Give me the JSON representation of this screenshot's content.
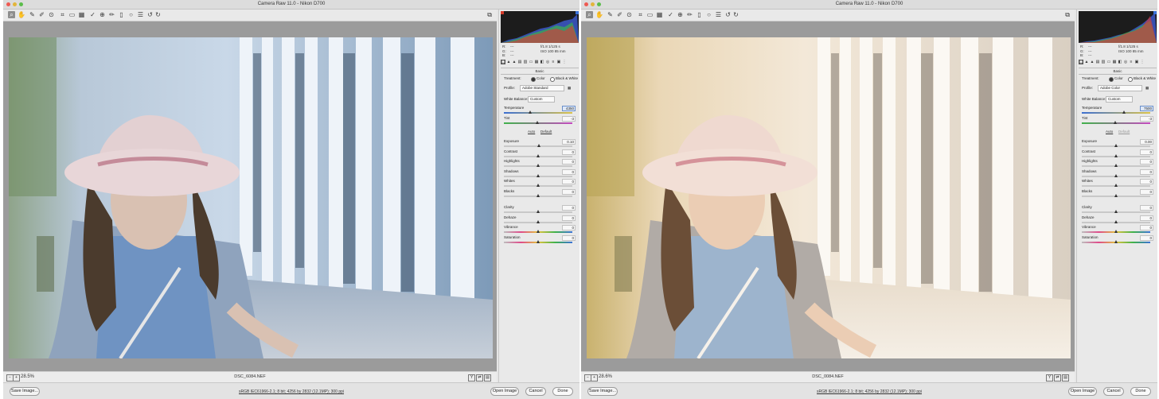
{
  "left": {
    "title": "Camera Raw 11.0  -  Nikon D700",
    "zoom": "28.5%",
    "filename": "DSC_6084.NEF",
    "info": "sRGB IEC61966-2.1; 8 bit; 4256 by 2832 (12.1MP); 300 ppi",
    "tonal": "cool",
    "readout": [
      {
        "label": "R:",
        "left": "---",
        "right": "f/1.8   1/125 s"
      },
      {
        "label": "G:",
        "left": "---",
        "right": "ISO 100   85 mm"
      },
      {
        "label": "B:",
        "left": "---",
        "right": ""
      }
    ],
    "basic": {
      "section_label": "Basic",
      "treatment_label": "Treatment:",
      "treatment_color": "Color",
      "treatment_bw": "Black & White",
      "profile_label": "Profile:",
      "profile_value": "Adobe Standard",
      "wb_label": "White Balance:",
      "wb_value": "Custom",
      "auto_link": "Auto",
      "default_link": "Default",
      "temperature": {
        "label": "Temperature",
        "value": "4350",
        "pos": 0.38,
        "highlight": true
      },
      "tint": {
        "label": "Tint",
        "value": "-3",
        "pos": 0.49,
        "highlight": false
      },
      "sliders": [
        {
          "label": "Exposure",
          "value": "0.10",
          "pos": 0.51
        },
        {
          "label": "Contrast",
          "value": "0",
          "pos": 0.5
        },
        {
          "label": "Highlights",
          "value": "0",
          "pos": 0.5
        },
        {
          "label": "Shadows",
          "value": "0",
          "pos": 0.5
        },
        {
          "label": "Whites",
          "value": "0",
          "pos": 0.5
        },
        {
          "label": "Blacks",
          "value": "0",
          "pos": 0.5
        },
        {
          "label": "Clarity",
          "value": "0",
          "pos": 0.5
        },
        {
          "label": "Dehaze",
          "value": "0",
          "pos": 0.5
        },
        {
          "label": "Vibrance",
          "value": "0",
          "pos": 0.5
        },
        {
          "label": "Saturation",
          "value": "0",
          "pos": 0.5
        }
      ]
    }
  },
  "right": {
    "title": "Camera Raw 11.0  -  Nikon D700",
    "zoom": "28.6%",
    "filename": "DSC_0084.NEF",
    "info": "sRGB IEC61966-2.1; 8 bit; 4256 by 2832 (12.1MP); 300 ppi",
    "tonal": "warm",
    "readout": [
      {
        "label": "R:",
        "left": "---",
        "right": "f/1.8   1/125 s"
      },
      {
        "label": "G:",
        "left": "---",
        "right": "ISO 100   85 mm"
      },
      {
        "label": "B:",
        "left": "---",
        "right": ""
      }
    ],
    "basic": {
      "section_label": "Basic",
      "treatment_label": "Treatment:",
      "treatment_color": "Color",
      "treatment_bw": "Black & White",
      "profile_label": "Profile:",
      "profile_value": "Adobe Color",
      "wb_label": "White Balance:",
      "wb_value": "Custom",
      "auto_link": "Auto",
      "default_link": "Default",
      "temperature": {
        "label": "Temperature",
        "value": "7500",
        "pos": 0.62,
        "highlight": true
      },
      "tint": {
        "label": "Tint",
        "value": "-3",
        "pos": 0.49,
        "highlight": false
      },
      "sliders": [
        {
          "label": "Exposure",
          "value": "0.00",
          "pos": 0.5
        },
        {
          "label": "Contrast",
          "value": "0",
          "pos": 0.5
        },
        {
          "label": "Highlights",
          "value": "0",
          "pos": 0.5
        },
        {
          "label": "Shadows",
          "value": "0",
          "pos": 0.5
        },
        {
          "label": "Whites",
          "value": "0",
          "pos": 0.5
        },
        {
          "label": "Blacks",
          "value": "0",
          "pos": 0.5
        },
        {
          "label": "Clarity",
          "value": "0",
          "pos": 0.5
        },
        {
          "label": "Dehaze",
          "value": "0",
          "pos": 0.5
        },
        {
          "label": "Vibrance",
          "value": "0",
          "pos": 0.5
        },
        {
          "label": "Saturation",
          "value": "0",
          "pos": 0.5
        }
      ]
    }
  },
  "footer": {
    "save_image": "Save Image...",
    "open_image": "Open Image",
    "cancel": "Cancel",
    "done": "Done"
  },
  "colors": {
    "close": "#ee5a52",
    "minimize": "#e2b53b",
    "maximize": "#5bbd4b",
    "cool_tint": "#8fb3d4",
    "warm_tint": "#e8cfa6"
  }
}
